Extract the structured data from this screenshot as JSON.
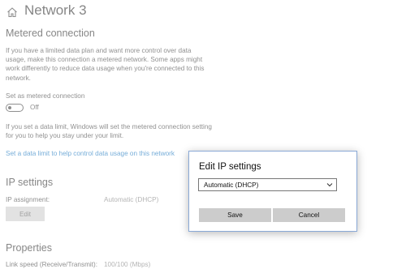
{
  "header": {
    "title": "Network  3"
  },
  "metered": {
    "heading": "Metered connection",
    "description": "If you have a limited data plan and want more control over data usage, make this connection a metered network. Some apps might work differently to reduce data usage when you're connected to this network.",
    "toggle_label": "Set as metered connection",
    "toggle_state": "Off",
    "limit_text": "If you set a data limit, Windows will set the metered connection setting for you to help you stay under your limit.",
    "limit_link": "Set a data limit to help control data usage on this network"
  },
  "ip_settings": {
    "heading": "IP settings",
    "assignment_label": "IP assignment:",
    "assignment_value": "Automatic (DHCP)",
    "edit_label": "Edit"
  },
  "properties": {
    "heading": "Properties",
    "link_speed_label": "Link speed (Receive/Transmit):",
    "link_speed_value": "100/100 (Mbps)"
  },
  "dialog": {
    "title": "Edit IP settings",
    "select_value": "Automatic (DHCP)",
    "save_label": "Save",
    "cancel_label": "Cancel"
  }
}
